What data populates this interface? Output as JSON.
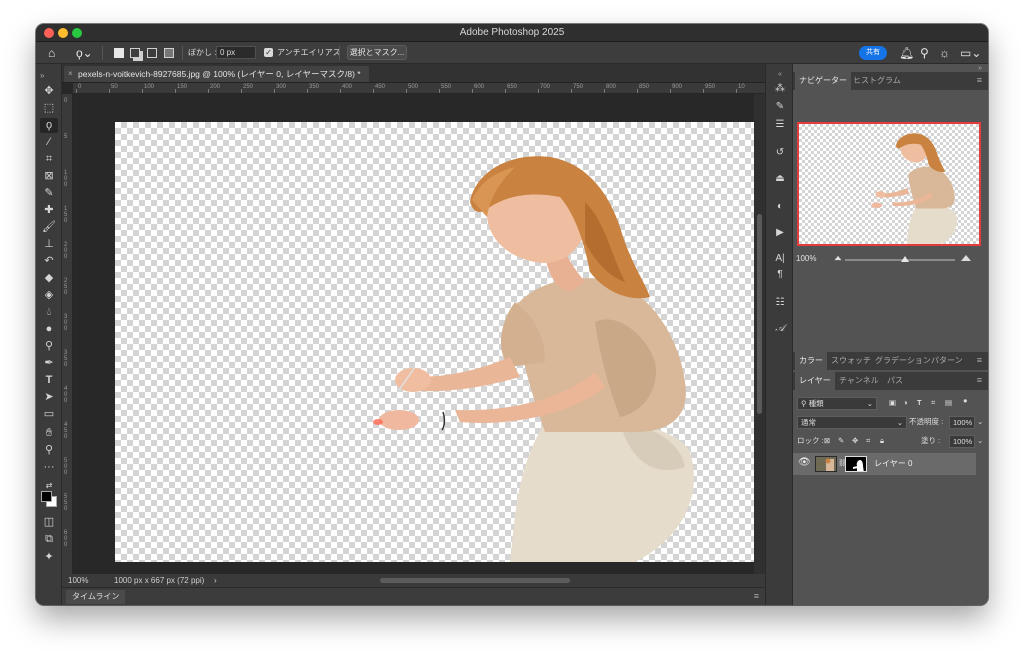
{
  "window": {
    "title": "Adobe Photoshop 2025"
  },
  "options_bar": {
    "feather_label": "ぼかし :",
    "feather_value": "0 px",
    "antialias_label": "アンチエイリアス",
    "select_mask_label": "選択とマスク...",
    "share_label": "共有"
  },
  "document": {
    "tab_title": "pexels-n-voitkevich-8927685.jpg @ 100% (レイヤー 0, レイヤーマスク/8) *",
    "ruler_h": [
      "0",
      "50",
      "100",
      "150",
      "200",
      "250",
      "300",
      "350",
      "400",
      "450",
      "500",
      "550",
      "600",
      "650",
      "700",
      "750",
      "800",
      "850",
      "900",
      "950",
      "10"
    ],
    "ruler_v": [
      "0",
      "5",
      "1 0 0",
      "1 5 0",
      "2 0 0",
      "2 5 0",
      "3 0 0",
      "3 5 0",
      "4 0 0",
      "4 5 0",
      "5 0 0",
      "5 5 0",
      "6 0 0"
    ],
    "zoom": "100%",
    "status": "1000 px x 667 px (72 ppi)",
    "status_arrow": "›"
  },
  "timeline": {
    "label": "タイムライン"
  },
  "navigator": {
    "tabs": [
      "ナビゲーター",
      "ヒストグラム"
    ],
    "zoom": "100%"
  },
  "color_panel": {
    "tabs": [
      "カラー",
      "スウォッチ",
      "グラデーション",
      "パターン"
    ]
  },
  "layers_panel": {
    "tabs": [
      "レイヤー",
      "チャンネル",
      "パス"
    ],
    "filter_value": "種類",
    "blend_mode": "通常",
    "opacity_label": "不透明度 :",
    "opacity_value": "100%",
    "lock_label": "ロック :",
    "fill_label": "塗り :",
    "fill_value": "100%",
    "layers": [
      {
        "name": "レイヤー 0"
      }
    ]
  },
  "colors": {
    "accent": "#1473e6",
    "nav_frame": "#e23c3c",
    "foreground": "#000000",
    "background": "#ffffff"
  }
}
